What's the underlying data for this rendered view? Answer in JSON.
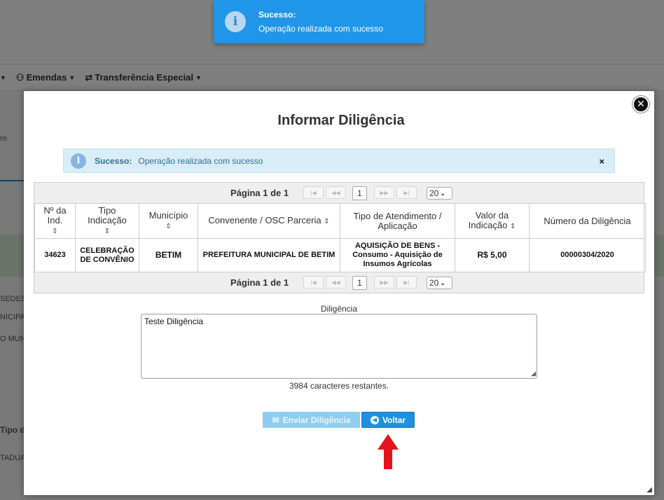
{
  "background": {
    "nav_items": [
      {
        "icon": "user-icon",
        "label": "Emendas"
      },
      {
        "icon": "transfer-icon",
        "label": "Transferência Especial"
      }
    ],
    "side_texts": [
      "ro",
      "SEDES",
      "NICIPA",
      "O MUN",
      "Tipo d",
      "TADUA"
    ]
  },
  "toast": {
    "title": "Sucesso:",
    "message": "Operação realizada com sucesso",
    "color": "#2196e8"
  },
  "modal": {
    "title": "Informar Diligência",
    "alert": {
      "title": "Sucesso:",
      "message": "Operação realizada com sucesso",
      "close": "×"
    },
    "pager": {
      "label": "Página 1 de 1",
      "current_page": "1",
      "page_size": "20",
      "buttons": [
        "first",
        "prev",
        "next",
        "last"
      ]
    },
    "table": {
      "headers": [
        {
          "label": "Nº da Ind.",
          "sortable": true
        },
        {
          "label": "Tipo Indicação",
          "sortable": true
        },
        {
          "label": "Município",
          "sortable": true
        },
        {
          "label": "Convenente / OSC Parceria",
          "sortable": true
        },
        {
          "label": "Tipo de Atendimento / Aplicação",
          "sortable": false
        },
        {
          "label": "Valor da Indicação",
          "sortable": true
        },
        {
          "label": "Número da Diligência",
          "sortable": false
        }
      ],
      "rows": [
        [
          "34623",
          "CELEBRAÇÃO DE CONVÊNIO",
          "BETIM",
          "PREFEITURA MUNICIPAL DE BETIM",
          "AQUISIÇÃO DE BENS - Consumo - Aquisição de Insumos Agrícolas",
          "R$ 5,00",
          "00000304/2020"
        ]
      ]
    },
    "form": {
      "label": "Diligência",
      "value": "Teste Diligência",
      "remaining": "3984 caracteres restantes."
    },
    "buttons": {
      "send": "Enviar Diligência",
      "back": "Voltar"
    }
  }
}
